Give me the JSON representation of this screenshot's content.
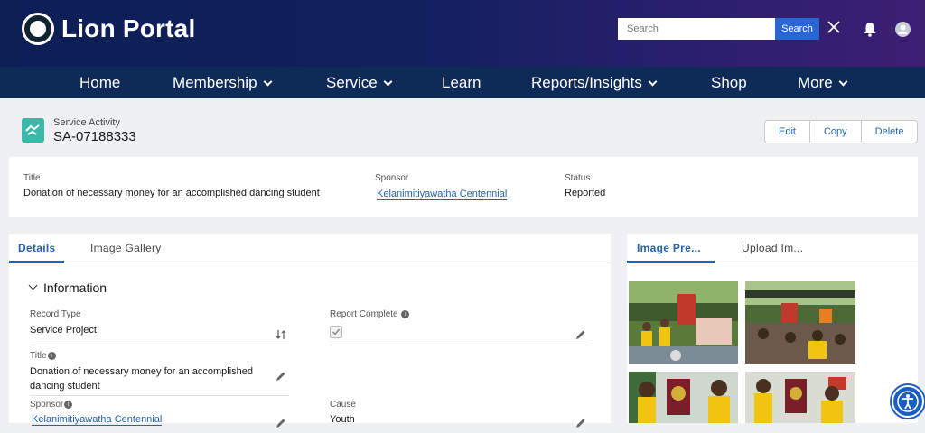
{
  "header": {
    "brand": "Lion Portal",
    "search_placeholder": "Search",
    "search_button": "Search"
  },
  "nav": {
    "items": [
      {
        "label": "Home"
      },
      {
        "label": "Membership"
      },
      {
        "label": "Service"
      },
      {
        "label": "Learn"
      },
      {
        "label": "Reports/Insights"
      },
      {
        "label": "Shop"
      },
      {
        "label": "More"
      }
    ]
  },
  "record": {
    "type": "Service Activity",
    "id": "SA-07188333",
    "actions": [
      "Edit",
      "Copy",
      "Delete"
    ]
  },
  "highlights": {
    "title_label": "Title",
    "title_value": "Donation of necessary money for an accomplished dancing student",
    "sponsor_label": "Sponsor",
    "sponsor_value": "Kelanimitiyawatha Centennial",
    "status_label": "Status",
    "status_value": "Reported"
  },
  "details": {
    "tabs": [
      "Details",
      "Image Gallery"
    ],
    "section_title": "Information",
    "fields": {
      "record_type_label": "Record Type",
      "record_type_value": "Service Project",
      "report_complete_label": "Report Complete",
      "report_complete_checked": true,
      "title_label": "Title",
      "title_value_line1": "Donation of necessary money for an accomplished",
      "title_value_line2": "dancing student",
      "sponsor_label": "Sponsor",
      "sponsor_value": "Kelanimitiyawatha Centennial",
      "cause_label": "Cause",
      "cause_value": "Youth"
    }
  },
  "side": {
    "tabs": [
      "Image Pre...",
      "Upload Im..."
    ]
  },
  "colors": {
    "header_start": "#0d1e55",
    "header_end": "#3d1f72",
    "nav_bg": "#0e2a57",
    "accent": "#2563ae",
    "record_icon": "#3ab8a8"
  }
}
